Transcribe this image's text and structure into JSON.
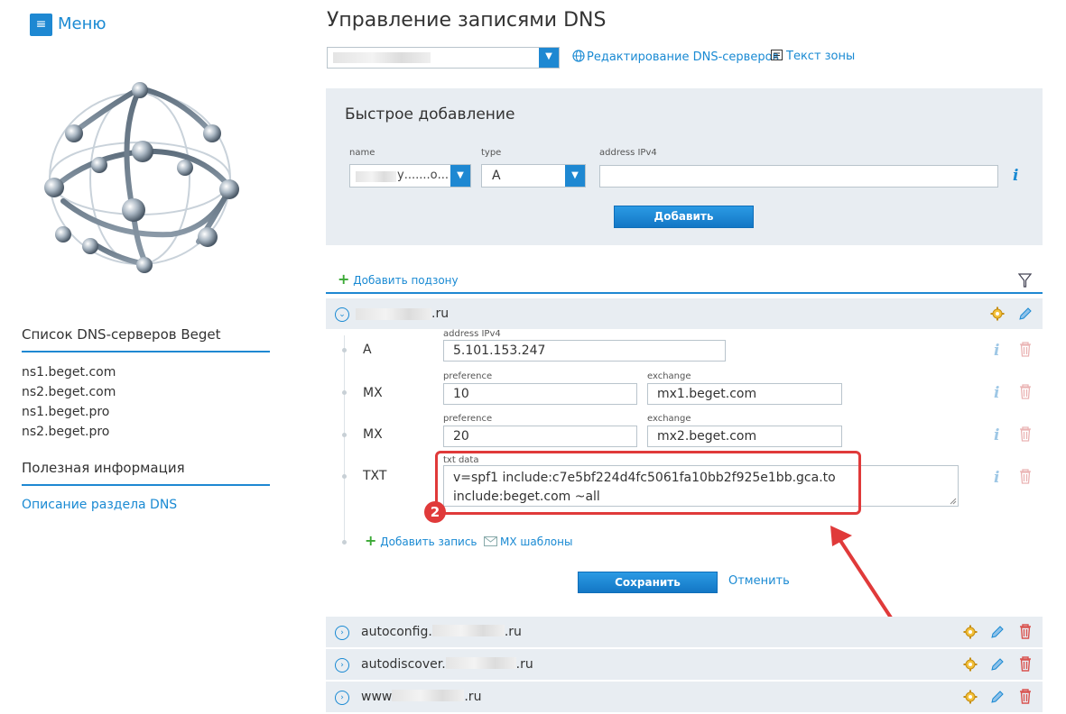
{
  "sidebar": {
    "menu_icon": "hamburger-icon",
    "menu_label": "Меню",
    "dns_servers_title": "Список DNS-серверов Beget",
    "ns_servers": [
      "ns1.beget.com",
      "ns2.beget.com",
      "ns1.beget.pro",
      "ns2.beget.pro"
    ],
    "useful_title": "Полезная информация",
    "dns_description_link": "Описание раздела DNS"
  },
  "header": {
    "title": "Управление записями DNS",
    "dns_edit_link": "Редактирование DNS-серверов",
    "zone_text_link": "Текст зоны"
  },
  "quick_add": {
    "title": "Быстрое добавление",
    "name_label": "name",
    "name_value_suffix": "у.......о...",
    "type_label": "type",
    "type_value": "A",
    "address_label": "address IPv4",
    "address_value": "",
    "add_button": "Добавить"
  },
  "subzone": {
    "add_subzone": "Добавить подзону"
  },
  "main_zone": {
    "name_suffix": ".ru",
    "records": [
      {
        "type": "A",
        "label": "address IPv4",
        "value": "5.101.153.247"
      },
      {
        "type": "MX",
        "pref_label": "preference",
        "pref": "10",
        "ex_label": "exchange",
        "exchange": "mx1.beget.com"
      },
      {
        "type": "MX",
        "pref_label": "preference",
        "pref": "20",
        "ex_label": "exchange",
        "exchange": "mx2.beget.com"
      },
      {
        "type": "TXT",
        "label": "txt data",
        "line1": "v=spf1 include:c7e5bf224d4fc5061fa10bb2f925e1bb.gca.to",
        "line2": "include:beget.com ~all"
      }
    ],
    "add_record": "Добавить запись",
    "mx_templates": "MX шаблоны",
    "save_button": "Сохранить",
    "cancel_link": "Отменить"
  },
  "annotation": {
    "badge_number": "2",
    "highlight_color": "#e03a3a"
  },
  "other_zones": [
    {
      "prefix": "autoconfig.",
      "suffix": ".ru"
    },
    {
      "prefix": "autodiscover.",
      "suffix": ".ru"
    },
    {
      "prefix": "www",
      "suffix": ".ru"
    }
  ],
  "colors": {
    "accent": "#1e88d2",
    "panel": "#e8edf2",
    "danger": "#d9534f"
  }
}
